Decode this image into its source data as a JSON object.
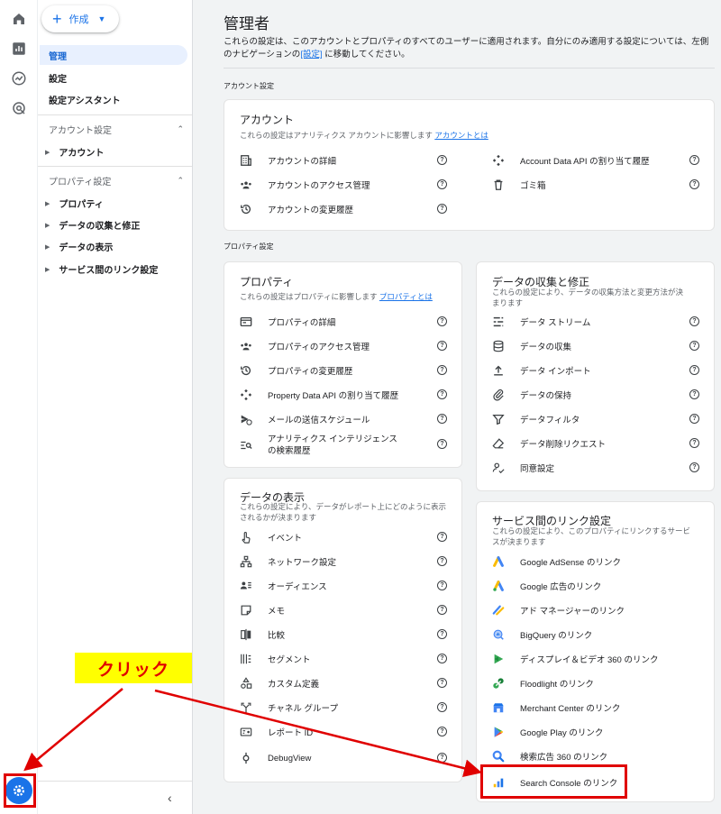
{
  "left_nav": {
    "create_label": "作成",
    "items": [
      {
        "label": "管理",
        "active": true
      },
      {
        "label": "設定"
      },
      {
        "label": "設定アシスタント"
      }
    ],
    "account_section": "アカウント設定",
    "account_items": [
      "アカウント"
    ],
    "property_section": "プロパティ設定",
    "property_items": [
      "プロパティ",
      "データの収集と修正",
      "データの表示",
      "サービス間のリンク設定"
    ]
  },
  "main": {
    "title": "管理者",
    "description_pre": "これらの設定は、このアカウントとプロパティのすべてのユーザーに適用されます。自分にのみ適用する設定については、左側のナビゲーションの",
    "description_link": "[設定]",
    "description_post": "に移動してください。",
    "account_settings_label": "アカウント設定",
    "property_settings_label": "プロパティ設定"
  },
  "account_card": {
    "title": "アカウント",
    "subtitle": "これらの設定はアナリティクス アカウントに影響します",
    "subtitle_link": "アカウントとは",
    "left_items": [
      "アカウントの詳細",
      "アカウントのアクセス管理",
      "アカウントの変更履歴"
    ],
    "right_items": [
      "Account Data API の割り当て履歴",
      "ゴミ箱"
    ]
  },
  "property_card": {
    "title": "プロパティ",
    "subtitle": "これらの設定はプロパティに影響します",
    "subtitle_link": "プロパティとは",
    "items": [
      "プロパティの詳細",
      "プロパティのアクセス管理",
      "プロパティの変更履歴",
      "Property Data API の割り当て履歴",
      "メールの送信スケジュール",
      "アナリティクス インテリジェンスの検索履歴"
    ]
  },
  "collection_card": {
    "title": "データの収集と修正",
    "subtitle": "これらの設定により、データの収集方法と変更方法が決まります",
    "items": [
      "データ ストリーム",
      "データの収集",
      "データ インポート",
      "データの保持",
      "データフィルタ",
      "データ削除リクエスト",
      "同意設定"
    ]
  },
  "display_card": {
    "title": "データの表示",
    "subtitle": "これらの設定により、データがレポート上にどのように表示されるかが決まります",
    "items": [
      "イベント",
      "ネットワーク設定",
      "オーディエンス",
      "メモ",
      "比較",
      "セグメント",
      "カスタム定義",
      "チャネル グループ",
      "レポート ID",
      "DebugView"
    ]
  },
  "links_card": {
    "title": "サービス間のリンク設定",
    "subtitle": "これらの設定により、このプロパティにリンクするサービスが決まります",
    "items": [
      "Google AdSense のリンク",
      "Google 広告のリンク",
      "アド マネージャーのリンク",
      "BigQuery のリンク",
      "ディスプレイ＆ビデオ 360 のリンク",
      "Floodlight のリンク",
      "Merchant Center のリンク",
      "Google Play のリンク",
      "検索広告 360 のリンク",
      "Search Console のリンク"
    ]
  },
  "annotation": {
    "click_label": "クリック"
  },
  "colors": {
    "accent": "#1a73e8",
    "annotation_red": "#e00000",
    "annotation_yellow": "#ffff00"
  }
}
